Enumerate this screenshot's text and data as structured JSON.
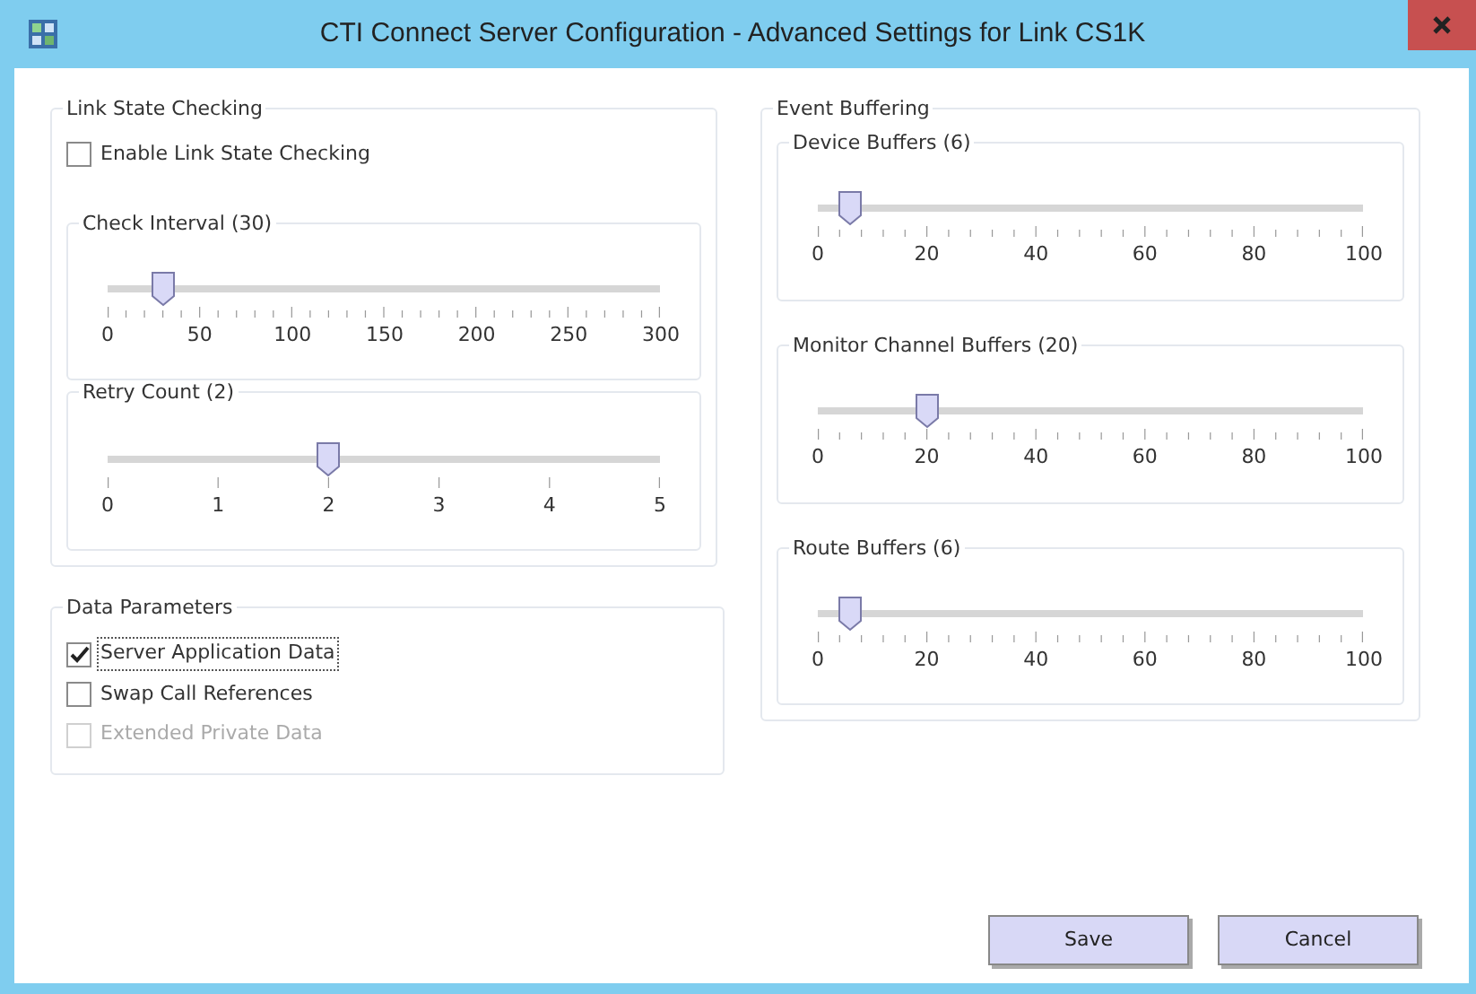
{
  "window": {
    "title": "CTI Connect Server Configuration - Advanced Settings for Link CS1K"
  },
  "link_state_checking": {
    "title": "Link State Checking",
    "checkboxes": [
      {
        "label": "Enable Link State Checking",
        "checked": false,
        "disabled": false,
        "focused": false
      }
    ],
    "sliders": [
      {
        "title": "Check Interval (30)",
        "kind": "fine",
        "level": 0.1,
        "tick_labels": [
          "0",
          "50",
          "100",
          "150",
          "200",
          "250",
          "300"
        ]
      },
      {
        "title": "Retry Count (2)",
        "kind": "coarse",
        "level": 0.4,
        "tick_labels": [
          "0",
          "1",
          "2",
          "3",
          "4",
          "5"
        ]
      }
    ]
  },
  "data_parameters": {
    "title": "Data Parameters",
    "checkboxes": [
      {
        "label": "Server Application Data",
        "checked": true,
        "disabled": false,
        "focused": true
      },
      {
        "label": "Swap Call References",
        "checked": false,
        "disabled": false,
        "focused": false
      },
      {
        "label": "Extended Private Data",
        "checked": false,
        "disabled": true,
        "focused": false
      }
    ]
  },
  "event_buffering": {
    "title": "Event Buffering",
    "sliders": [
      {
        "title": "Device Buffers (6)",
        "kind": "fine",
        "level": 0.06,
        "tick_labels": [
          "0",
          "20",
          "40",
          "60",
          "80",
          "100"
        ]
      },
      {
        "title": "Monitor Channel Buffers (20)",
        "kind": "fine",
        "level": 0.2,
        "tick_labels": [
          "0",
          "20",
          "40",
          "60",
          "80",
          "100"
        ]
      },
      {
        "title": "Route Buffers (6)",
        "kind": "fine",
        "level": 0.06,
        "tick_labels": [
          "0",
          "20",
          "40",
          "60",
          "80",
          "100"
        ]
      }
    ]
  },
  "buttons": [
    "Save",
    "Cancel"
  ]
}
